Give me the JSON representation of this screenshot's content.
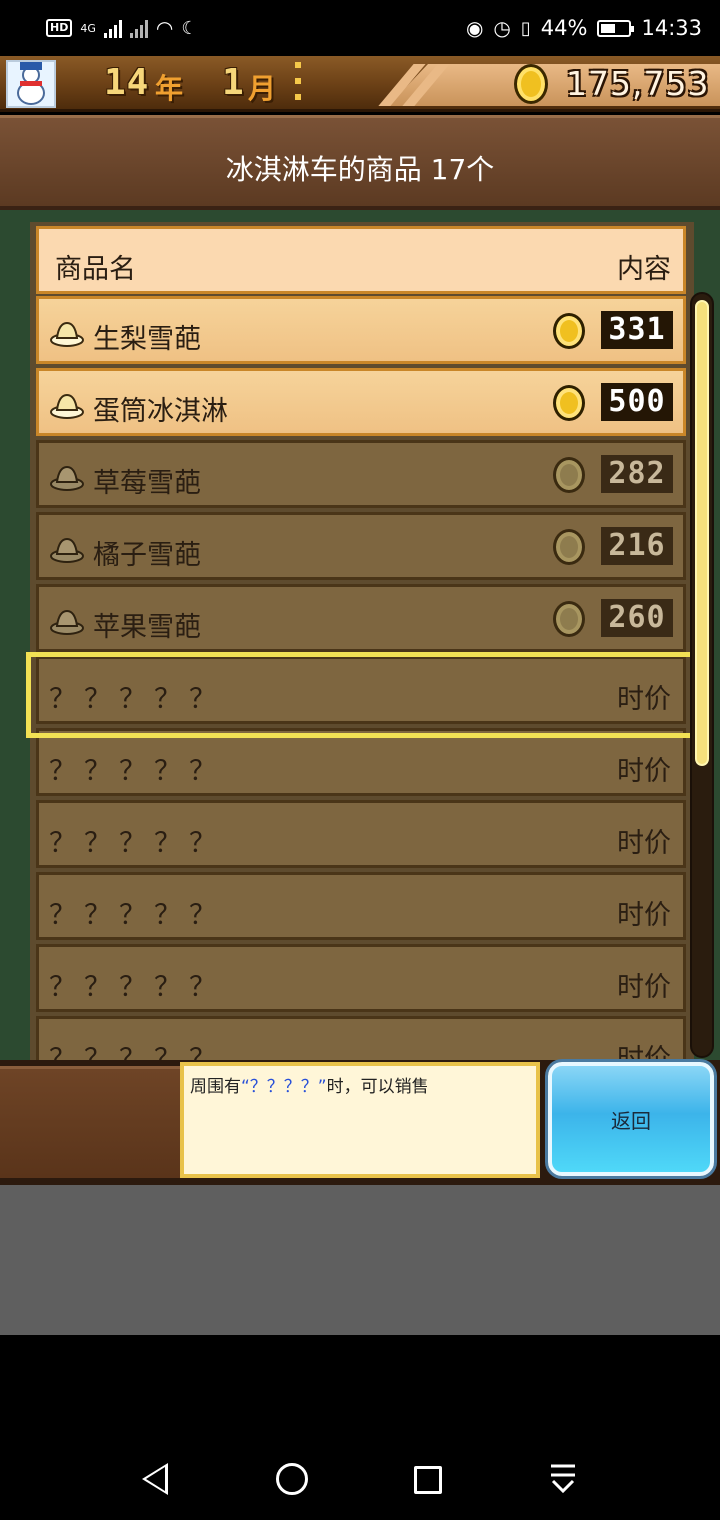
{
  "status_bar": {
    "left_badges": [
      "HD",
      "4G"
    ],
    "battery_percent": "44%",
    "time": "14:33"
  },
  "game_top": {
    "year": "14",
    "year_unit": "年",
    "month": "1",
    "month_unit": "月",
    "money": "175,753"
  },
  "title": "冰淇淋车的商品 17个",
  "table": {
    "header_name": "商品名",
    "header_content": "内容",
    "rows": [
      {
        "name": "生梨雪葩",
        "price": "331",
        "active": true
      },
      {
        "name": "蛋筒冰淇淋",
        "price": "500",
        "active": true
      },
      {
        "name": "草莓雪葩",
        "price": "282",
        "active": false
      },
      {
        "name": "橘子雪葩",
        "price": "216",
        "active": false
      },
      {
        "name": "苹果雪葩",
        "price": "260",
        "active": false
      },
      {
        "name": "？？？？？",
        "price_text": "时价",
        "unknown": true
      },
      {
        "name": "？？？？？",
        "price_text": "时价",
        "unknown": true
      },
      {
        "name": "？？？？？",
        "price_text": "时价",
        "unknown": true
      },
      {
        "name": "？？？？？",
        "price_text": "时价",
        "unknown": true
      },
      {
        "name": "？？？？？",
        "price_text": "时价",
        "unknown": true
      },
      {
        "name": "？？？？？",
        "price_text": "时价",
        "unknown": true
      }
    ]
  },
  "message": {
    "prefix": "周围有",
    "highlight": "“？？？？”",
    "suffix": "时，可以销售"
  },
  "back_button": "返回",
  "colors": {
    "highlight_border": "#f2e154",
    "active_row": "#f6d39a",
    "inactive_row": "#7e6640",
    "back_button": "#3cb4ea",
    "message_highlight": "#2850d8"
  },
  "icons": [
    "hd-icon",
    "signal-icon",
    "wifi-icon",
    "moon-icon",
    "eye-icon",
    "alarm-icon",
    "vibrate-icon",
    "battery-icon",
    "snowman-avatar-icon",
    "menu-dots-icon",
    "gold-coin-icon",
    "dessert-dish-icon",
    "nav-back-icon",
    "nav-home-icon",
    "nav-recent-icon",
    "nav-down-icon"
  ]
}
